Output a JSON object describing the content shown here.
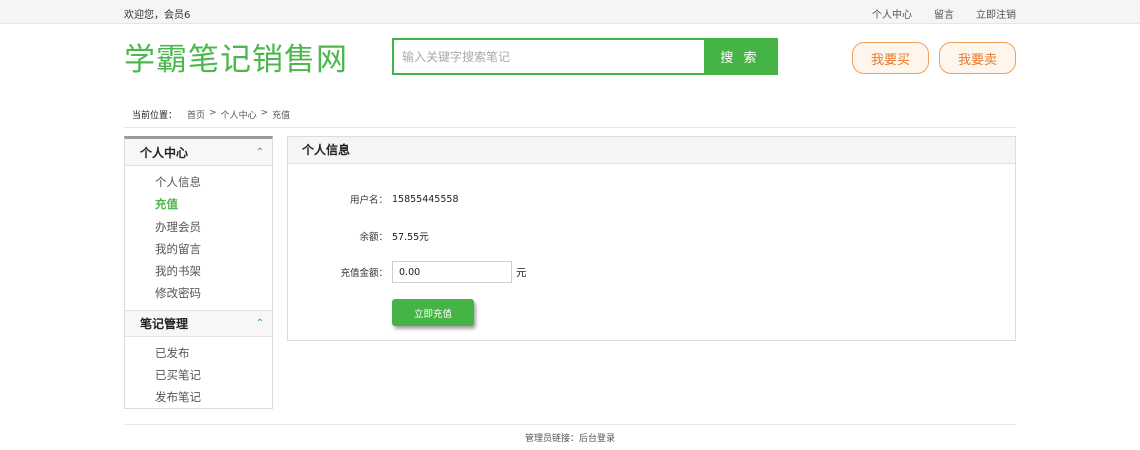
{
  "topbar": {
    "welcome": "欢迎您，会员6",
    "links": [
      "个人中心",
      "留言",
      "立即注销"
    ]
  },
  "header": {
    "logo": "学霸笔记销售网",
    "search_placeholder": "输入关键字搜索笔记",
    "search_button": "搜 索",
    "buy_button": "我要买",
    "sell_button": "我要卖"
  },
  "breadcrumb": {
    "label": "当前位置：",
    "path": [
      "首页",
      ">",
      "个人中心",
      ">",
      "充值"
    ]
  },
  "sidebar": {
    "sections": [
      {
        "title": "个人中心",
        "items": [
          "个人信息",
          "充值",
          "办理会员",
          "我的留言",
          "我的书架",
          "修改密码"
        ]
      },
      {
        "title": "笔记管理",
        "items": [
          "已发布",
          "已买笔记",
          "发布笔记"
        ]
      }
    ],
    "active_item": "充值"
  },
  "panel": {
    "title": "个人信息",
    "username_label": "用户名：",
    "username": "15855445558",
    "balance_label": "余额：",
    "balance": "57.55元",
    "amount_label": "充值金额：",
    "amount_value": "0.00",
    "amount_unit": "元",
    "submit": "立即充值"
  },
  "footer": {
    "text": "管理员链接：",
    "link": "后台登录"
  },
  "colors": {
    "brand_green": "#46b346",
    "accent_orange": "#e8792b"
  }
}
